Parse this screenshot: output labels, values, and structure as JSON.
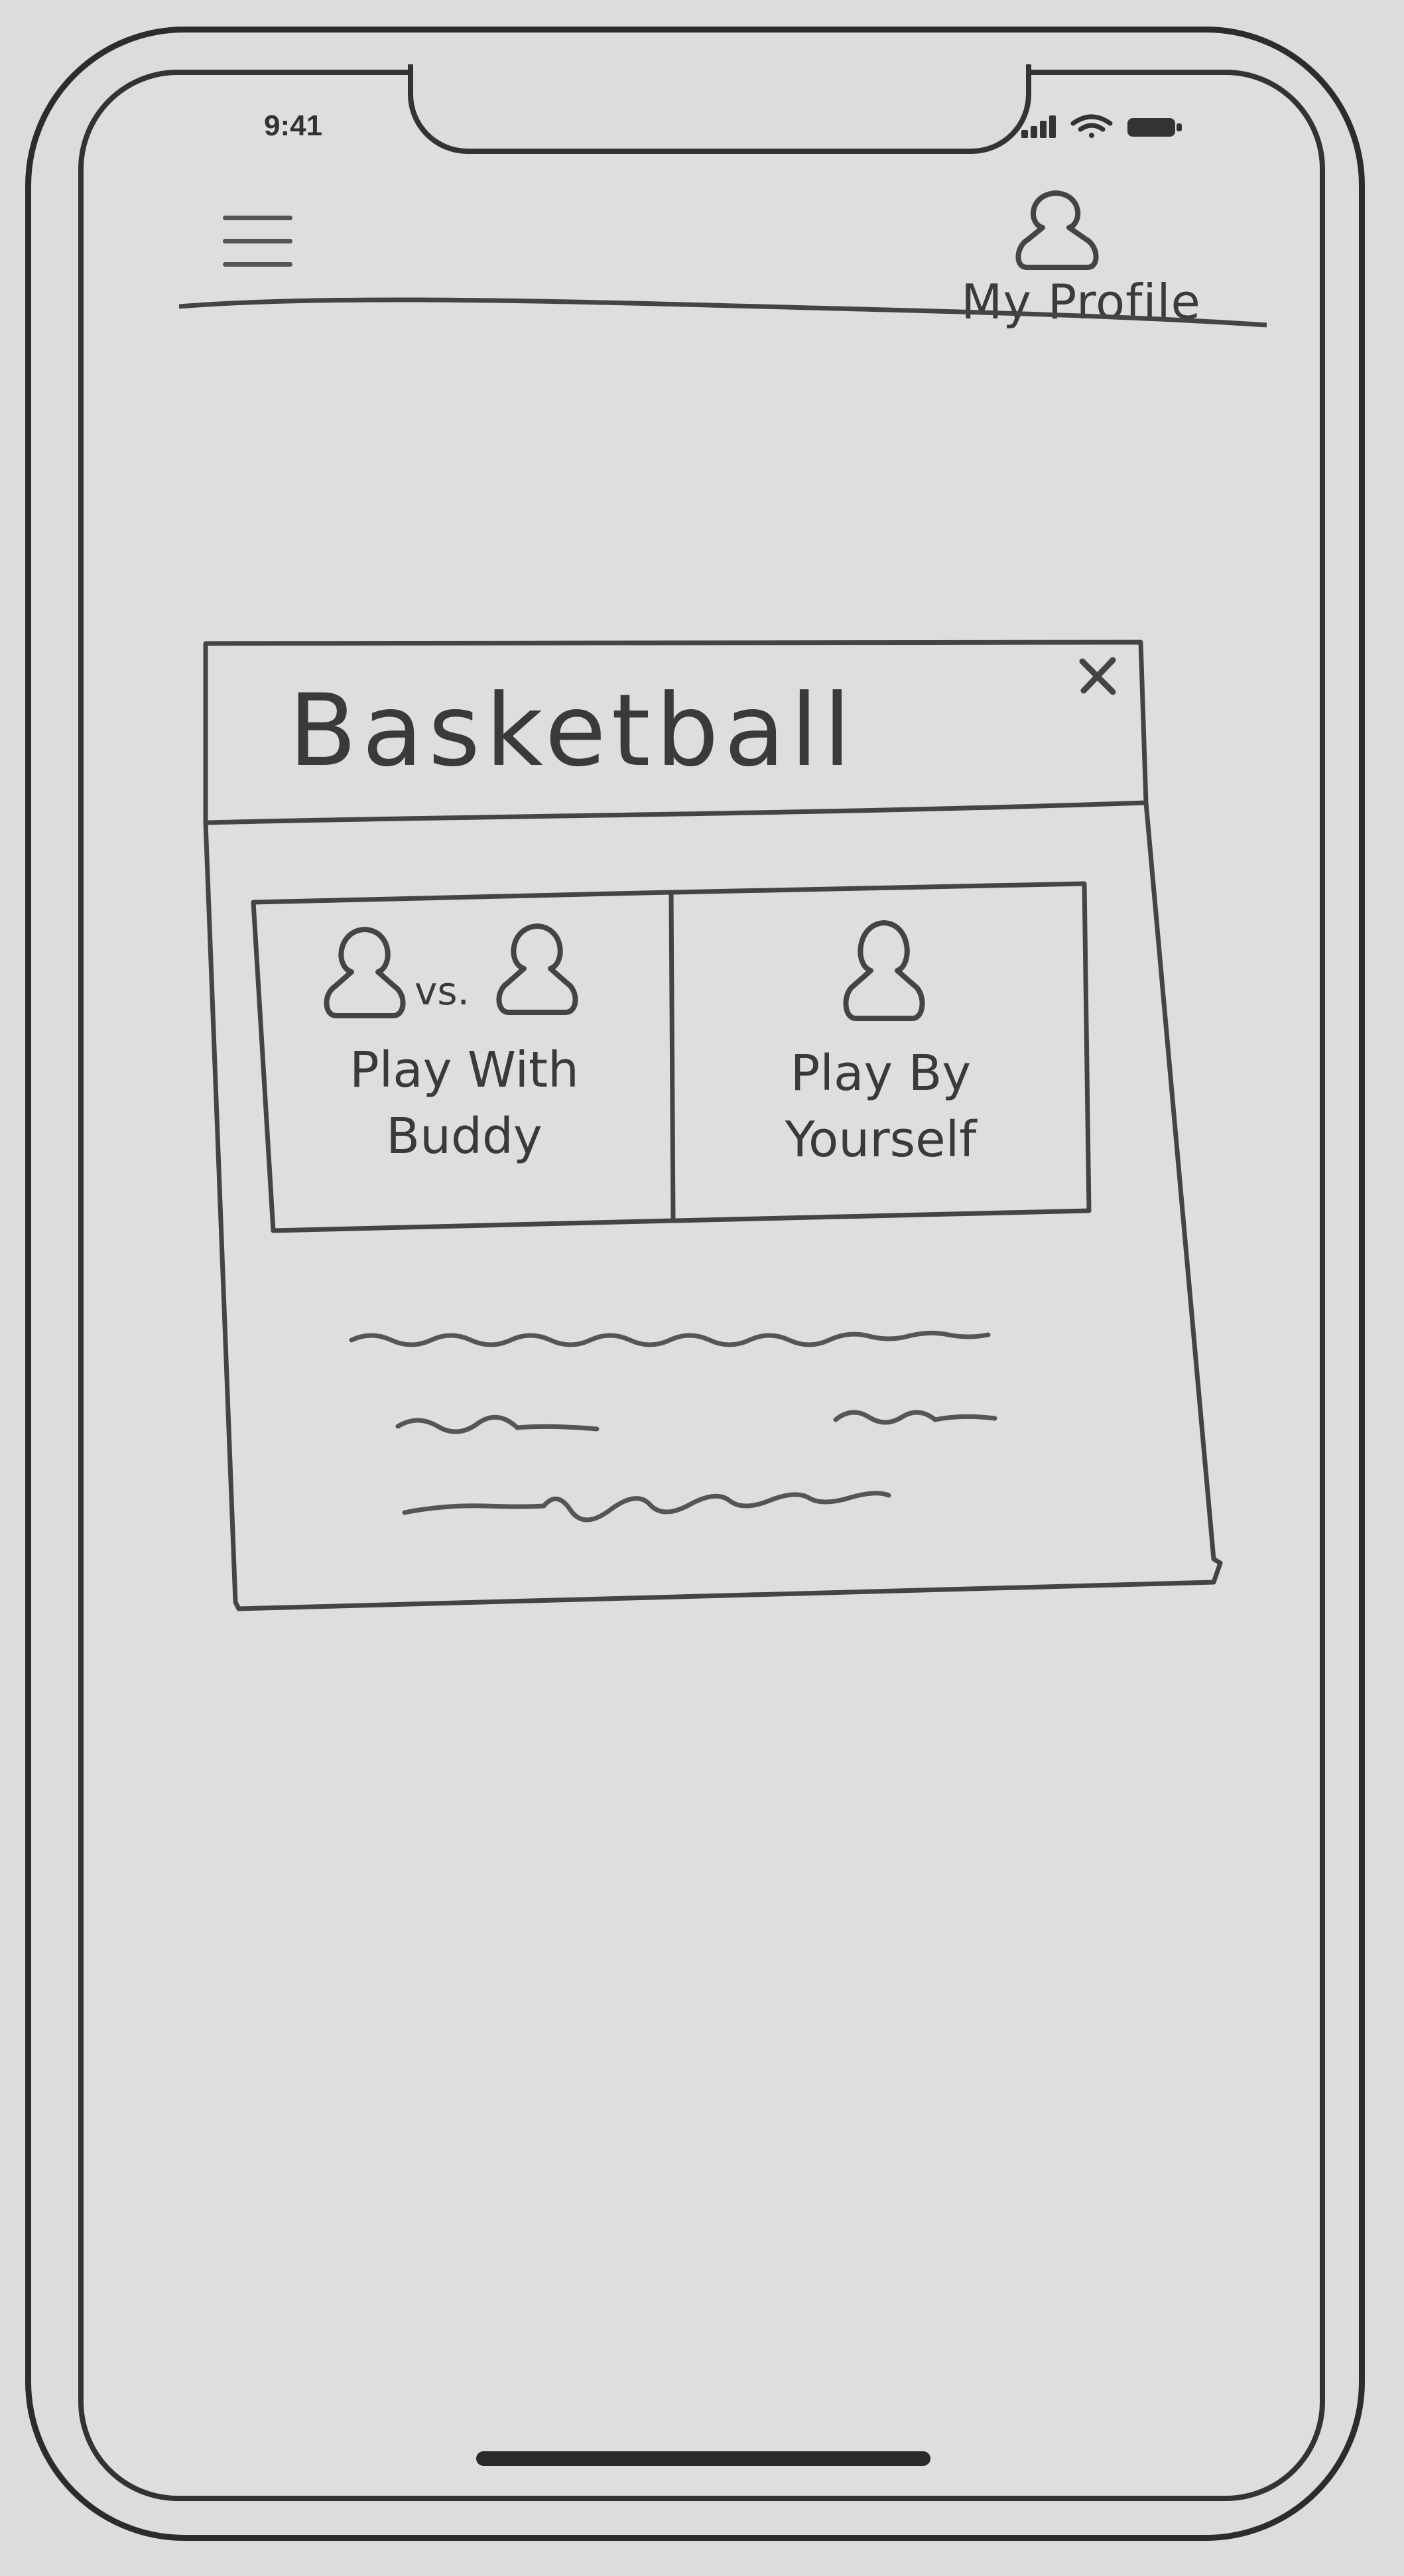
{
  "status_bar": {
    "time": "9:41",
    "icons": [
      "signal-icon",
      "wifi-icon",
      "battery-icon"
    ]
  },
  "header": {
    "menu_icon": "hamburger-menu-icon",
    "profile_icon": "person-icon",
    "profile_label": "My Profile"
  },
  "modal": {
    "title": "Basketball",
    "close_label": "x",
    "options": [
      {
        "icons": [
          "person-icon",
          "person-icon"
        ],
        "separator": "vs.",
        "line1": "Play With",
        "line2": "Buddy"
      },
      {
        "icons": [
          "person-icon"
        ],
        "line1": "Play By",
        "line2": "Yourself"
      }
    ],
    "description_placeholder": "squiggly-text-lines"
  }
}
